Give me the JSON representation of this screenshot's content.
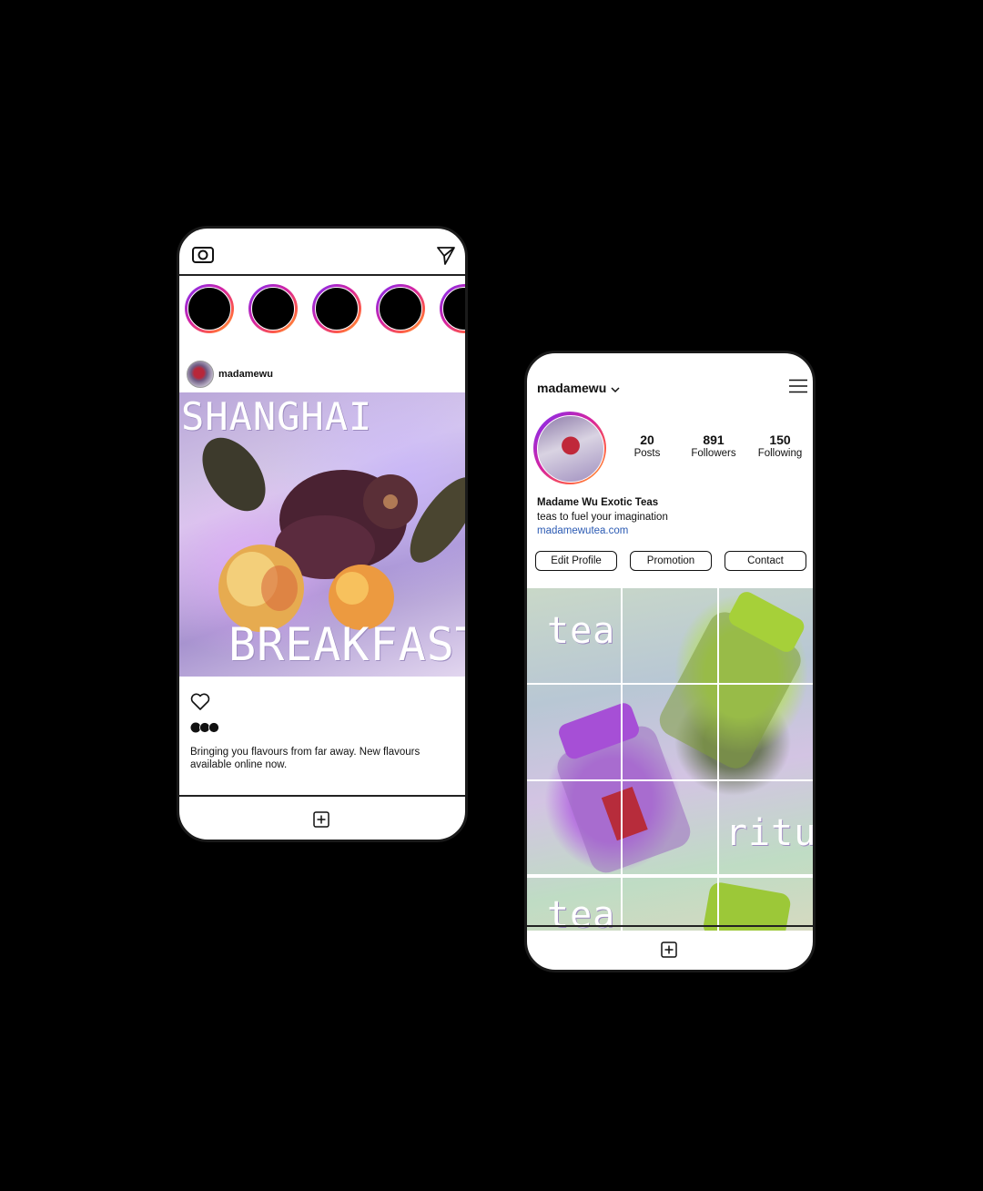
{
  "feed": {
    "username": "madamewu",
    "post_title_top": "SHANGHAI",
    "post_title_bottom": "BREAKFAST",
    "caption": "Bringing you flavours from far away. New flavours available online now."
  },
  "profile": {
    "username": "madamewu",
    "stats": [
      {
        "value": "20",
        "label": "Posts"
      },
      {
        "value": "891",
        "label": "Followers"
      },
      {
        "value": "150",
        "label": "Following"
      }
    ],
    "bio_name": "Madame Wu Exotic Teas",
    "bio_text": "teas to fuel your imagination",
    "bio_link": "madamewutea.com",
    "buttons": {
      "edit": "Edit Profile",
      "promotion": "Promotion",
      "contact": "Contact"
    },
    "grid_words": {
      "tea": "tea",
      "ritual": "ritual"
    }
  },
  "colors": {
    "story_ring": "#d6249f",
    "link": "#2b5ab3"
  },
  "icons": [
    "camera-icon",
    "send-icon",
    "heart-icon",
    "more-dots-icon",
    "add-post-icon",
    "chevron-down-icon",
    "menu-icon"
  ]
}
